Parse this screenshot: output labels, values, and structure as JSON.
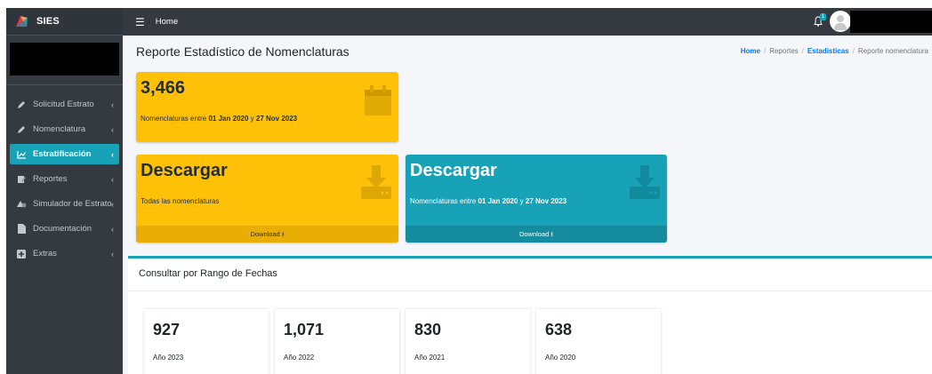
{
  "app": {
    "brand": "SIES"
  },
  "topbar": {
    "home": "Home",
    "notification_badge": "1"
  },
  "sidebar": {
    "items": [
      {
        "label": "Solicitud Estrato",
        "icon": "pen-icon"
      },
      {
        "label": "Nomenclatura",
        "icon": "pen-icon"
      },
      {
        "label": "Estratificación",
        "icon": "chart-icon",
        "active": true
      },
      {
        "label": "Reportes",
        "icon": "report-icon"
      },
      {
        "label": "Simulador de Estrato",
        "icon": "shapes-icon"
      },
      {
        "label": "Documentación",
        "icon": "file-icon"
      },
      {
        "label": "Extras",
        "icon": "plus-square-icon"
      }
    ]
  },
  "page": {
    "title": "Reporte Estadístico de Nomenclaturas"
  },
  "breadcrumb": {
    "home": "Home",
    "reportes": "Reportes",
    "estadisticas": "Estadísticas",
    "current": "Reporte nomenclatura"
  },
  "summary_box": {
    "value": "3,466",
    "text_prefix": "Nomenclaturas entre ",
    "date_from": "01 Jan 2020",
    "text_mid": " y ",
    "date_to": "27 Nov 2023"
  },
  "download_all": {
    "title": "Descargar",
    "subtitle": "Todas las nomenclaturas",
    "footer": "Download"
  },
  "download_range": {
    "title": "Descargar",
    "text_prefix": "Nomenclaturas entre ",
    "date_from": "01 Jan 2020",
    "text_mid": " y ",
    "date_to": "27 Nov 2023",
    "footer": "Download"
  },
  "range_card": {
    "title": "Consultar por Rango de Fechas",
    "stats": [
      {
        "value": "927",
        "label": "Año 2023"
      },
      {
        "value": "1,071",
        "label": "Año 2022"
      },
      {
        "value": "830",
        "label": "Año 2021"
      },
      {
        "value": "638",
        "label": "Año 2020"
      }
    ]
  },
  "colors": {
    "sidebar": "#343a40",
    "accent_teal": "#17a2b8",
    "warning_yellow": "#ffc107",
    "link_blue": "#007bff"
  }
}
